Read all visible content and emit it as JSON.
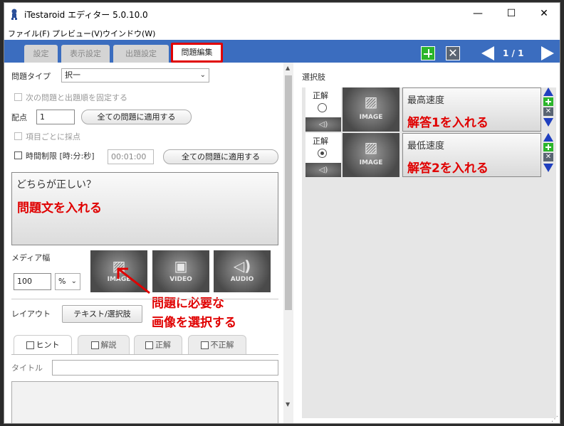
{
  "window": {
    "title": "iTestaroid エディター 5.0.10.0",
    "min": "—",
    "max": "☐",
    "close": "✕"
  },
  "menu": [
    "ファイル(F)",
    "プレビュー(V)",
    "ウインドウ(W)"
  ],
  "tabs": [
    "設定",
    "表示設定",
    "出題設定",
    "問題編集"
  ],
  "pager": "1 / 1",
  "editor": {
    "question_type_label": "問題タイプ",
    "question_type_value": "択一",
    "fix_order_label": "次の問題と出題順を固定する",
    "points_label": "配点",
    "points_value": "1",
    "apply_all_label": "全ての問題に適用する",
    "per_item_label": "項目ごとに採点",
    "time_limit_label": "時間制限 [時:分:秒]",
    "time_limit_value": "00:01:00",
    "apply_all_label2": "全ての問題に適用する",
    "question_text": "どちらが正しい？",
    "question_note": "問題文を入れる",
    "media_width_label": "メディア幅",
    "media_width_value": "100",
    "media_width_unit": "%",
    "media": [
      "IMAGE",
      "VIDEO",
      "AUDIO"
    ],
    "media_note_line1": "問題に必要な",
    "media_note_line2": "画像を選択する",
    "layout_label": "レイアウト",
    "layout_value": "テキスト/選択肢",
    "subtabs": [
      "ヒント",
      "解説",
      "正解",
      "不正解"
    ],
    "title_label": "タイトル"
  },
  "choices": {
    "header": "選択肢",
    "items": [
      {
        "correct_label": "正解",
        "image": "IMAGE",
        "text": "最高速度",
        "note": "解答1を入れる",
        "selected": false
      },
      {
        "correct_label": "正解",
        "image": "IMAGE",
        "text": "最低速度",
        "note": "解答2を入れる",
        "selected": true
      }
    ]
  },
  "colors": {
    "accent": "#3b6dbf",
    "highlight": "#e00000",
    "add": "#2bb52b"
  }
}
